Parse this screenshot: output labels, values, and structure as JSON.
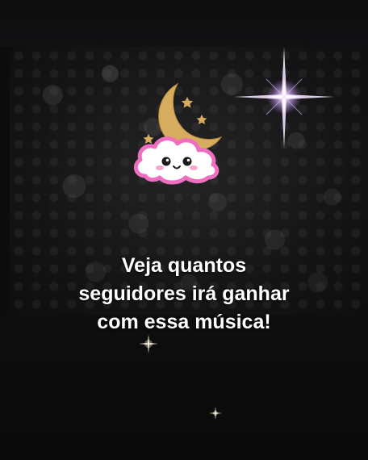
{
  "caption": {
    "line1": "Veja quantos",
    "line2": "seguidores irá ganhar",
    "line3": "com essa música!"
  },
  "icons": {
    "emblem": "moon-cloud-icon",
    "sparkle_large": "sparkle-icon",
    "sparkle_small": "small-sparkle-icon"
  },
  "colors": {
    "background": "#0c0c0d",
    "moon": "#d6ad5e",
    "cloud_outline": "#f06ec0",
    "text": "#ffffff",
    "sparkle": "#e6c8ff"
  }
}
